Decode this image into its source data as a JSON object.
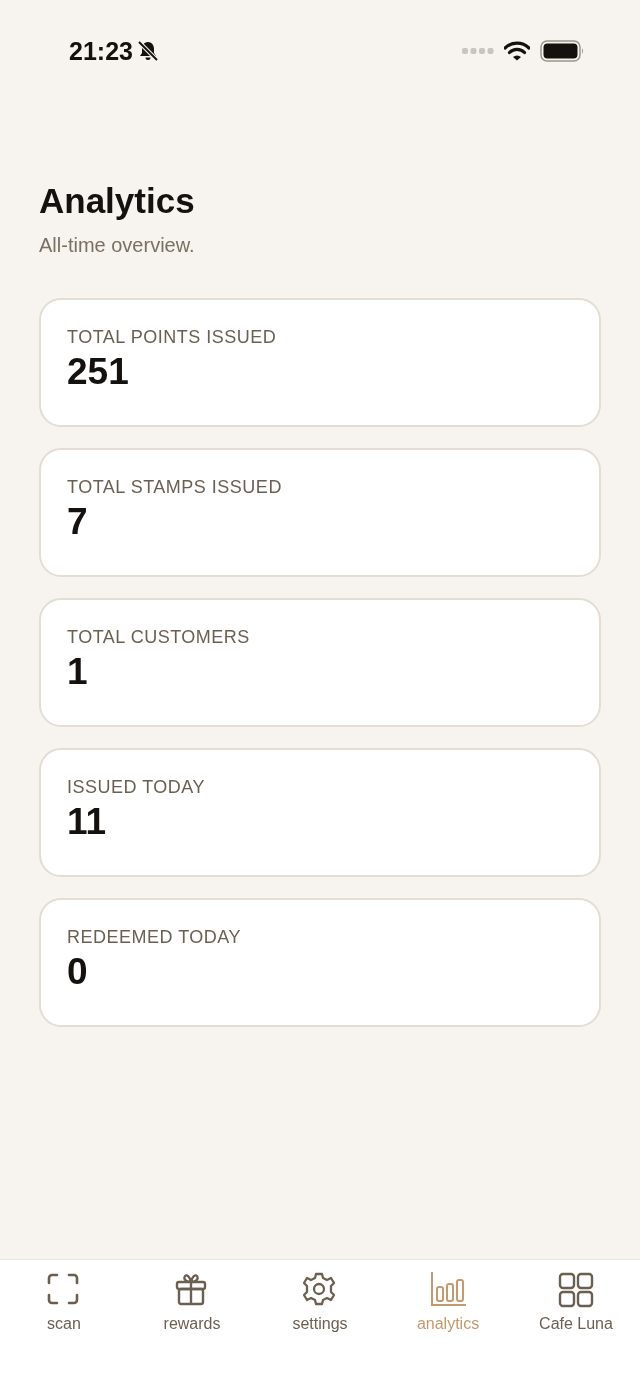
{
  "status_bar": {
    "time": "21:23",
    "silent": true
  },
  "title": "Analytics",
  "subtitle": "All-time overview.",
  "stats": [
    {
      "label": "TOTAL POINTS ISSUED",
      "value": "251"
    },
    {
      "label": "TOTAL STAMPS ISSUED",
      "value": "7"
    },
    {
      "label": "TOTAL CUSTOMERS",
      "value": "1"
    },
    {
      "label": "ISSUED TODAY",
      "value": "11"
    },
    {
      "label": "REDEEMED TODAY",
      "value": "0"
    }
  ],
  "tabs": [
    {
      "kind": "scan",
      "label": "scan",
      "selected": false
    },
    {
      "kind": "gift",
      "label": "rewards",
      "selected": false
    },
    {
      "kind": "gear",
      "label": "settings",
      "selected": false
    },
    {
      "kind": "chart",
      "label": "analytics",
      "selected": true
    },
    {
      "kind": "grid",
      "label": "Cafe Luna",
      "selected": false
    }
  ]
}
